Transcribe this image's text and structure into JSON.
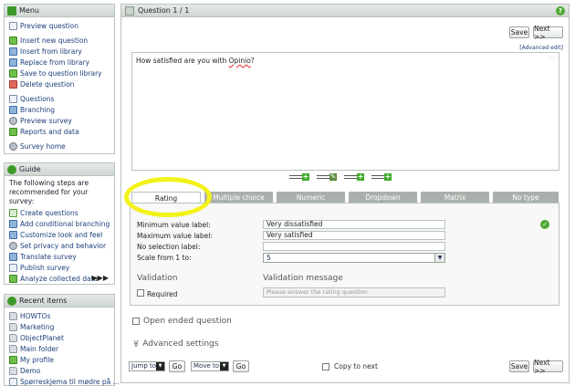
{
  "menu": {
    "title": "Menu",
    "items": [
      {
        "label": "Preview question",
        "icon": "preview-icon"
      },
      {
        "label": "Insert new question",
        "icon": "insert-icon"
      },
      {
        "label": "Insert from library",
        "icon": "library-icon"
      },
      {
        "label": "Replace from library",
        "icon": "replace-icon"
      },
      {
        "label": "Save to question library",
        "icon": "save-icon"
      },
      {
        "label": "Delete question",
        "icon": "delete-icon"
      },
      {
        "label": "Questions",
        "icon": "questions-icon"
      },
      {
        "label": "Branching",
        "icon": "branching-icon"
      },
      {
        "label": "Preview survey",
        "icon": "preview-survey-icon"
      },
      {
        "label": "Reports and data",
        "icon": "reports-icon"
      },
      {
        "label": "Survey home",
        "icon": "home-icon"
      }
    ]
  },
  "guide": {
    "title": "Guide",
    "text": "The following steps are recommended for your survey:",
    "items": [
      {
        "label": "Create questions"
      },
      {
        "label": "Add conditional branching"
      },
      {
        "label": "Customize look and feel"
      },
      {
        "label": "Set privacy and behavior"
      },
      {
        "label": "Translate survey"
      },
      {
        "label": "Publish survey"
      },
      {
        "label": "Analyze collected data"
      }
    ],
    "more": "▶▶▶"
  },
  "recent": {
    "title": "Recent items",
    "items": [
      {
        "label": "HOWTOs"
      },
      {
        "label": "Marketing"
      },
      {
        "label": "ObjectPlanet"
      },
      {
        "label": "Main folder"
      },
      {
        "label": "My profile"
      },
      {
        "label": "Demo"
      },
      {
        "label": "Spørreskjema til mødre på ..."
      }
    ]
  },
  "main": {
    "title": "Question 1 / 1",
    "help": "?",
    "save_label": "Save",
    "next_label": "Next >>",
    "advanced_edit": "[Advanced edit]",
    "question_text_before": "How satisfied are you with ",
    "question_text_spell": "Opinio",
    "question_text_after": "?",
    "tabs": [
      {
        "label": "Rating",
        "active": true
      },
      {
        "label": "Multiple choice",
        "active": false
      },
      {
        "label": "Numeric",
        "active": false
      },
      {
        "label": "Dropdown",
        "active": false
      },
      {
        "label": "Matrix",
        "active": false
      },
      {
        "label": "No type",
        "active": false
      }
    ],
    "rating": {
      "min_label": "Minimum value label:",
      "min_value": "Very dissatisfied",
      "max_label": "Maximum value label:",
      "max_value": "Very satisfied",
      "nosel_label": "No selection label:",
      "nosel_value": "",
      "scale_label": "Scale from 1 to:",
      "scale_value": "5"
    },
    "validation": {
      "title": "Validation",
      "msg_title": "Validation message",
      "required_label": "Required",
      "required_checked": false,
      "msg_placeholder": "Please answer the rating question."
    },
    "open_ended_label": "Open ended question",
    "advanced_settings_label": "Advanced settings",
    "advanced_settings_icon": "≫",
    "bottom": {
      "jump_to_label": "Jump to",
      "go_label": "Go",
      "move_to_label": "Move to",
      "copy_to_next_label": "Copy to next"
    }
  },
  "colors": {
    "highlight": "#f3f21a",
    "header_gradient_top": "#e6eae7",
    "header_gradient_bottom": "#cfd6d1",
    "tab_inactive": "#aab0ab",
    "accent_green": "#4fa836",
    "link_blue": "#1c3f7a"
  }
}
